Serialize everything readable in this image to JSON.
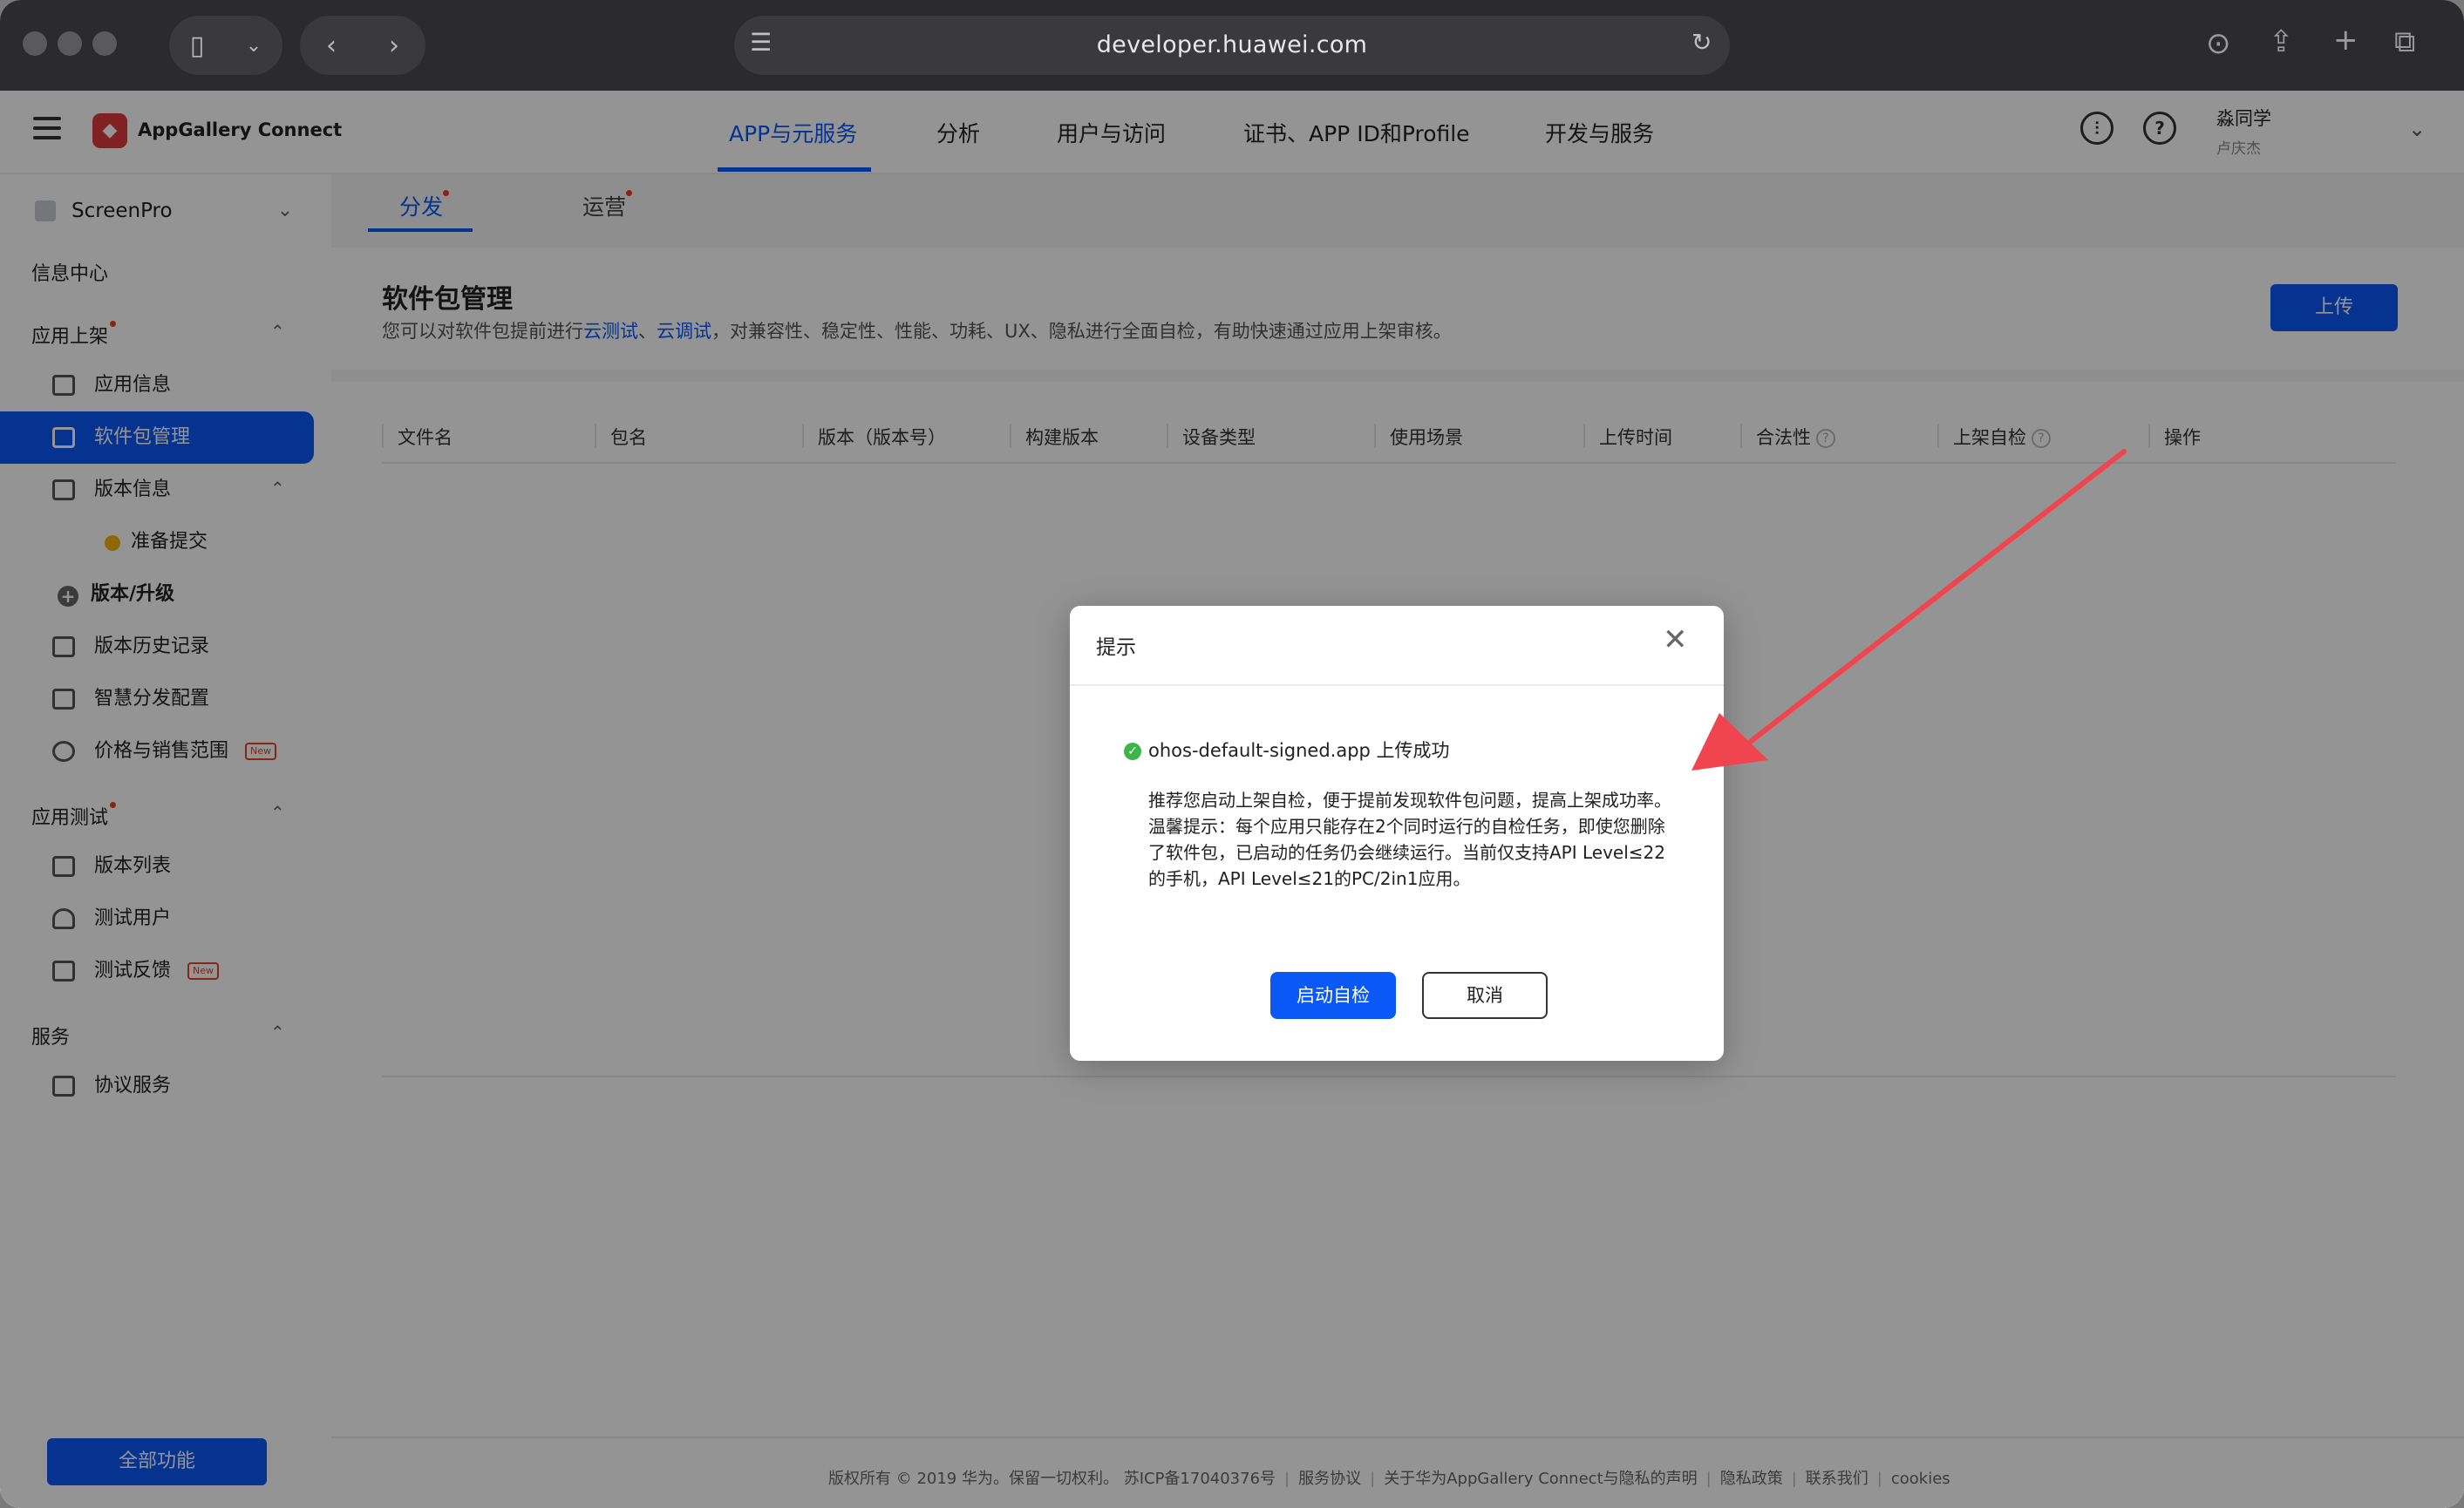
{
  "browser": {
    "url": "developer.huawei.com"
  },
  "app": {
    "logo_text": "AppGallery Connect",
    "nav": [
      "APP与元服务",
      "分析",
      "用户与访问",
      "证书、APP ID和Profile",
      "开发与服务"
    ],
    "user_name": "淼同学",
    "user_sub": "卢庆杰"
  },
  "sidebar": {
    "project": "ScreenPro",
    "info_center": "信息中心",
    "section_release": "应用上架",
    "items_release": [
      "应用信息",
      "软件包管理",
      "版本信息"
    ],
    "sub_prepare": "准备提交",
    "upgrade": "版本/升级",
    "items_release2": [
      "版本历史记录",
      "智慧分发配置",
      "价格与销售范围"
    ],
    "section_test": "应用测试",
    "items_test": [
      "版本列表",
      "测试用户",
      "测试反馈"
    ],
    "section_service": "服务",
    "items_service": [
      "协议服务"
    ],
    "new_badge": "New",
    "all_features": "全部功能"
  },
  "tabs": {
    "distribute": "分发",
    "operate": "运营"
  },
  "page": {
    "title": "软件包管理",
    "desc_prefix": "您可以对软件包提前进行",
    "desc_link1": "云测试",
    "desc_sep": "、",
    "desc_link2": "云调试",
    "desc_suffix": "，对兼容性、稳定性、性能、功耗、UX、隐私进行全面自检，有助快速通过应用上架审核。",
    "upload": "上传"
  },
  "table": {
    "columns": [
      "文件名",
      "包名",
      "版本（版本号）",
      "构建版本",
      "设备类型",
      "使用场景",
      "上传时间",
      "合法性",
      "上架自检",
      "操作"
    ]
  },
  "footer": {
    "copyright": "版权所有 © 2019 华为。保留一切权利。 苏ICP备17040376号",
    "links": [
      "服务协议",
      "关于华为AppGallery Connect与隐私的声明",
      "隐私政策",
      "联系我们",
      "cookies"
    ]
  },
  "dialog": {
    "title": "提示",
    "success": "ohos-default-signed.app 上传成功",
    "line1": "推荐您启动上架自检，便于提前发现软件包问题，提高上架成功率。",
    "line2": "温馨提示：每个应用只能存在2个同时运行的自检任务，即使您删除了软件包，已启动的任务仍会继续运行。当前仅支持API Level≤22的手机，API Level≤21的PC/2in1应用。",
    "confirm": "启动自检",
    "cancel": "取消"
  },
  "colors": {
    "primary": "#0a59f7",
    "annotation_arrow": "#f0454f",
    "success": "#3cb54a"
  }
}
